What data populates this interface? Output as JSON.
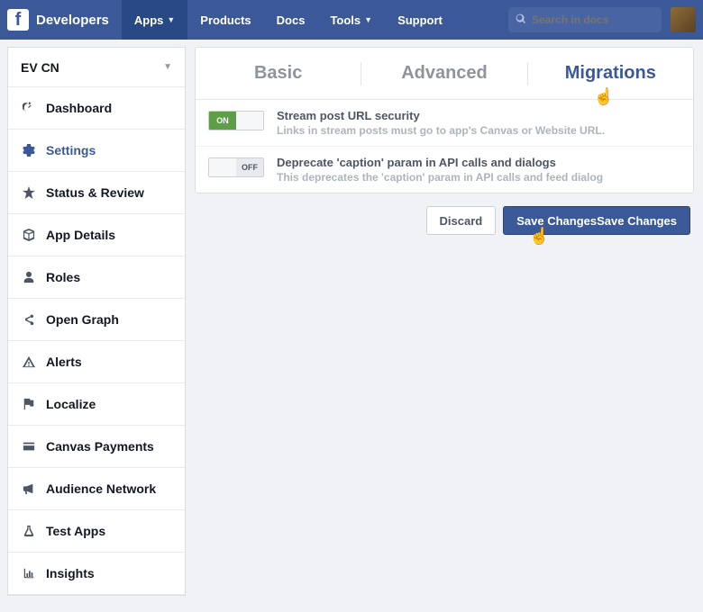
{
  "topbar": {
    "brand": "Developers",
    "nav": [
      "Apps",
      "Products",
      "Docs",
      "Tools",
      "Support"
    ],
    "nav_has_caret": [
      true,
      false,
      false,
      true,
      false
    ],
    "active_nav_index": 0,
    "search_placeholder": "Search in docs"
  },
  "sidebar": {
    "app_name": "EV CN",
    "items": [
      {
        "label": "Dashboard",
        "icon": "speedometer"
      },
      {
        "label": "Settings",
        "icon": "gear"
      },
      {
        "label": "Status & Review",
        "icon": "star"
      },
      {
        "label": "App Details",
        "icon": "cube"
      },
      {
        "label": "Roles",
        "icon": "person"
      },
      {
        "label": "Open Graph",
        "icon": "share"
      },
      {
        "label": "Alerts",
        "icon": "warning"
      },
      {
        "label": "Localize",
        "icon": "flag"
      },
      {
        "label": "Canvas Payments",
        "icon": "card"
      },
      {
        "label": "Audience Network",
        "icon": "megaphone"
      },
      {
        "label": "Test Apps",
        "icon": "flask"
      },
      {
        "label": "Insights",
        "icon": "chart"
      }
    ],
    "active_index": 1
  },
  "tabs": {
    "items": [
      "Basic",
      "Advanced",
      "Migrations"
    ],
    "active_index": 2
  },
  "settings": [
    {
      "state": "on",
      "title": "Stream post URL security",
      "desc": "Links in stream posts must go to app's Canvas or Website URL."
    },
    {
      "state": "off",
      "title": "Deprecate 'caption' param in API calls and dialogs",
      "desc": "This deprecates the 'caption' param in API calls and feed dialog"
    }
  ],
  "toggle_labels": {
    "on": "ON",
    "off": "OFF"
  },
  "actions": {
    "discard": "Discard",
    "save": "Save Changes"
  }
}
